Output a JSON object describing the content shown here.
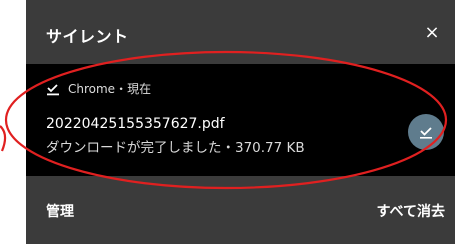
{
  "header": {
    "title": "サイレント",
    "close_label": "×"
  },
  "notification": {
    "app_name": "Chrome・現在",
    "file_name": "20220425155357627.pdf",
    "status": "ダウンロードが完了しました",
    "separator": "・",
    "size": "370.77 KB"
  },
  "footer": {
    "manage_label": "管理",
    "clear_all_label": "すべて消去"
  },
  "icons": {
    "app": "download-done-icon",
    "action": "download-done-icon",
    "close": "close-icon"
  },
  "colors": {
    "panel": "#3b3b3b",
    "card": "#000000",
    "action_circle": "#5f7c8d",
    "annotation": "#e02020"
  }
}
